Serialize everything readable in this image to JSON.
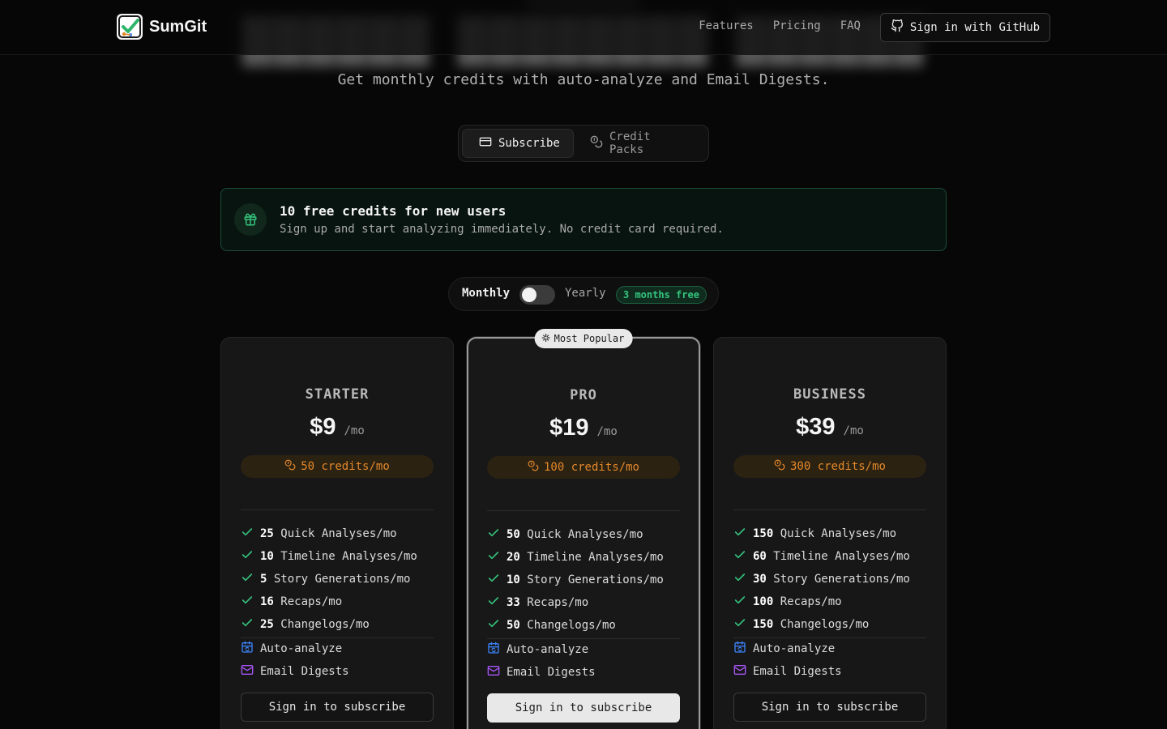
{
  "nav": {
    "brand": "SumGit",
    "links": [
      "Features",
      "Pricing",
      "FAQ"
    ],
    "github_button": "Sign in with GitHub"
  },
  "hero": {
    "subtitle": "Get monthly credits with auto-analyze and Email Digests."
  },
  "tabs": [
    {
      "label": "Subscribe",
      "icon": "credit-card-icon",
      "active": true
    },
    {
      "label": "Credit Packs",
      "icon": "coins-icon",
      "active": false
    }
  ],
  "banner": {
    "title": "10 free credits for new users",
    "text": "Sign up and start analyzing immediately. No credit card required."
  },
  "billing": {
    "monthly": "Monthly",
    "yearly": "Yearly",
    "promo": "3 months free",
    "yearly_selected": false
  },
  "popular_badge": "Most Popular",
  "plans": [
    {
      "name": "STARTER",
      "price": "$9",
      "per": "/mo",
      "credits": "50 credits/mo",
      "features": [
        {
          "count": "25",
          "label": "Quick Analyses/mo"
        },
        {
          "count": "10",
          "label": "Timeline Analyses/mo"
        },
        {
          "count": "5",
          "label": "Story Generations/mo"
        },
        {
          "count": "16",
          "label": "Recaps/mo"
        },
        {
          "count": "25",
          "label": "Changelogs/mo"
        }
      ],
      "extras": [
        "Auto-analyze",
        "Email Digests"
      ],
      "cta": "Sign in to subscribe"
    },
    {
      "name": "PRO",
      "price": "$19",
      "per": "/mo",
      "credits": "100 credits/mo",
      "features": [
        {
          "count": "50",
          "label": "Quick Analyses/mo"
        },
        {
          "count": "20",
          "label": "Timeline Analyses/mo"
        },
        {
          "count": "10",
          "label": "Story Generations/mo"
        },
        {
          "count": "33",
          "label": "Recaps/mo"
        },
        {
          "count": "50",
          "label": "Changelogs/mo"
        }
      ],
      "extras": [
        "Auto-analyze",
        "Email Digests"
      ],
      "cta": "Sign in to subscribe"
    },
    {
      "name": "BUSINESS",
      "price": "$39",
      "per": "/mo",
      "credits": "300 credits/mo",
      "features": [
        {
          "count": "150",
          "label": "Quick Analyses/mo"
        },
        {
          "count": "60",
          "label": "Timeline Analyses/mo"
        },
        {
          "count": "30",
          "label": "Story Generations/mo"
        },
        {
          "count": "100",
          "label": "Recaps/mo"
        },
        {
          "count": "150",
          "label": "Changelogs/mo"
        }
      ],
      "extras": [
        "Auto-analyze",
        "Email Digests"
      ],
      "cta": "Sign in to subscribe"
    }
  ],
  "colors": {
    "accent_green": "#35c47d",
    "credits_orange": "#e5882a",
    "extra_blue": "#3b82f6",
    "extra_purple": "#a855f7"
  }
}
